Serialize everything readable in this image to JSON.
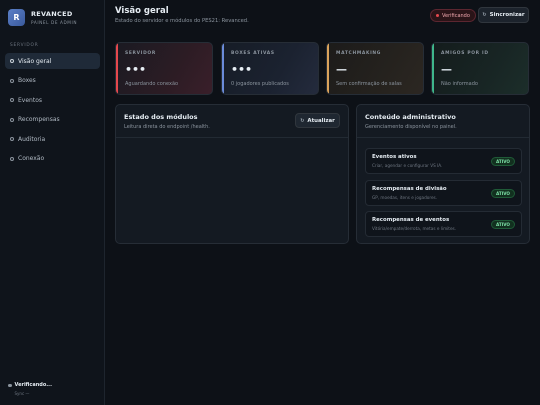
{
  "brand": {
    "initial": "R",
    "name": "REVANCED",
    "subtitle": "PAINEL DE ADMIN"
  },
  "sidebar": {
    "section_label": "SERVIDOR",
    "items": [
      {
        "label": "Visão geral",
        "active": true
      },
      {
        "label": "Boxes",
        "active": false
      },
      {
        "label": "Eventos",
        "active": false
      },
      {
        "label": "Recompensas",
        "active": false
      },
      {
        "label": "Auditoria",
        "active": false
      },
      {
        "label": "Conexão",
        "active": false
      }
    ],
    "status": {
      "title": "Verificando...",
      "subtitle": "Sync —"
    }
  },
  "header": {
    "title": "Visão geral",
    "subtitle": "Estado do servidor e módulos do PES21: Revanced.",
    "verify_badge": "Verificando",
    "sync_label": "Sincronizar"
  },
  "stats": [
    {
      "label": "SERVIDOR",
      "value": "•••",
      "sub": "Aguardando conexão",
      "accent": "#e5484d"
    },
    {
      "label": "BOXES ATIVAS",
      "value": "•••",
      "sub": "0 jogadores publicados",
      "accent": "#6b8bd9"
    },
    {
      "label": "MATCHMAKING",
      "value": "—",
      "sub": "Sem confirmação de salas",
      "accent": "#d9a25b"
    },
    {
      "label": "AMIGOS POR ID",
      "value": "—",
      "sub": "Não informado",
      "accent": "#3fb68b"
    }
  ],
  "modules": {
    "title": "Estado dos módulos",
    "subtitle": "Leitura direta do endpoint /health.",
    "refresh_label": "Atualizar"
  },
  "admin": {
    "title": "Conteúdo administrativo",
    "subtitle": "Gerenciamento disponível no painel.",
    "items": [
      {
        "title": "Eventos ativos",
        "desc": "Criar, agendar e configurar VS IA.",
        "status": "ATIVO"
      },
      {
        "title": "Recompensas de divisão",
        "desc": "GP, moedas, itens e jogadores.",
        "status": "ATIVO"
      },
      {
        "title": "Recompensas de eventos",
        "desc": "Vitória/empate/derrota, metas e limites.",
        "status": "ATIVO"
      }
    ]
  }
}
